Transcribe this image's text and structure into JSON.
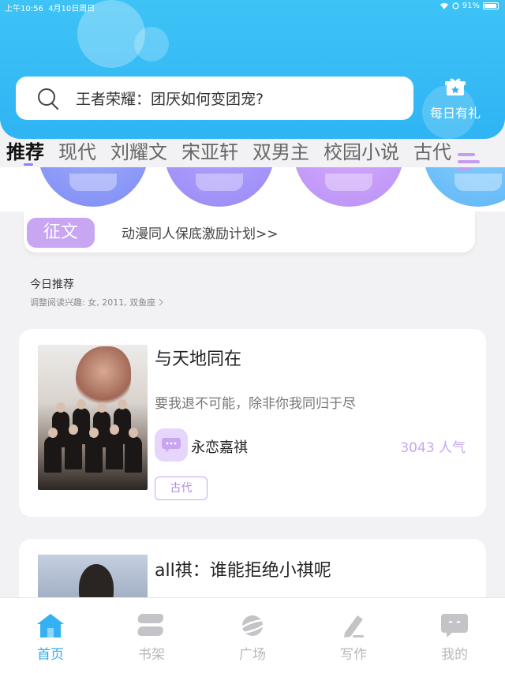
{
  "status_bar": {
    "time": "上午10:56",
    "date": "4月10日周日",
    "battery": "91%"
  },
  "search": {
    "placeholder": "王者荣耀：团厌如何变团宠?"
  },
  "gift": {
    "label": "每日有礼"
  },
  "tabs": [
    "推荐",
    "现代",
    "刘耀文",
    "宋亚轩",
    "双男主",
    "校园小说",
    "古代"
  ],
  "notice": {
    "badge": "征文",
    "text": "动漫同人保底激励计划>>"
  },
  "section": {
    "title": "今日推荐",
    "subtitle": "调整阅读兴趣: 女, 2011, 双鱼座"
  },
  "books": [
    {
      "title": "与天地同在",
      "desc": "要我退不可能，除非你我同归于尽",
      "author": "永恋嘉祺",
      "popularity": "3043 人气",
      "tag": "古代"
    },
    {
      "title": "all祺：谁能拒绝小祺呢"
    }
  ],
  "bottom_nav": [
    {
      "label": "首页",
      "icon": "home-icon",
      "active": true
    },
    {
      "label": "书架",
      "icon": "bookshelf-icon",
      "active": false
    },
    {
      "label": "广场",
      "icon": "planet-icon",
      "active": false
    },
    {
      "label": "写作",
      "icon": "pen-icon",
      "active": false
    },
    {
      "label": "我的",
      "icon": "profile-chat-icon",
      "active": false
    }
  ],
  "colors": {
    "header": "#2fb4f4",
    "accent_purple": "#c6a6f0",
    "nav_active": "#33a9f0"
  }
}
